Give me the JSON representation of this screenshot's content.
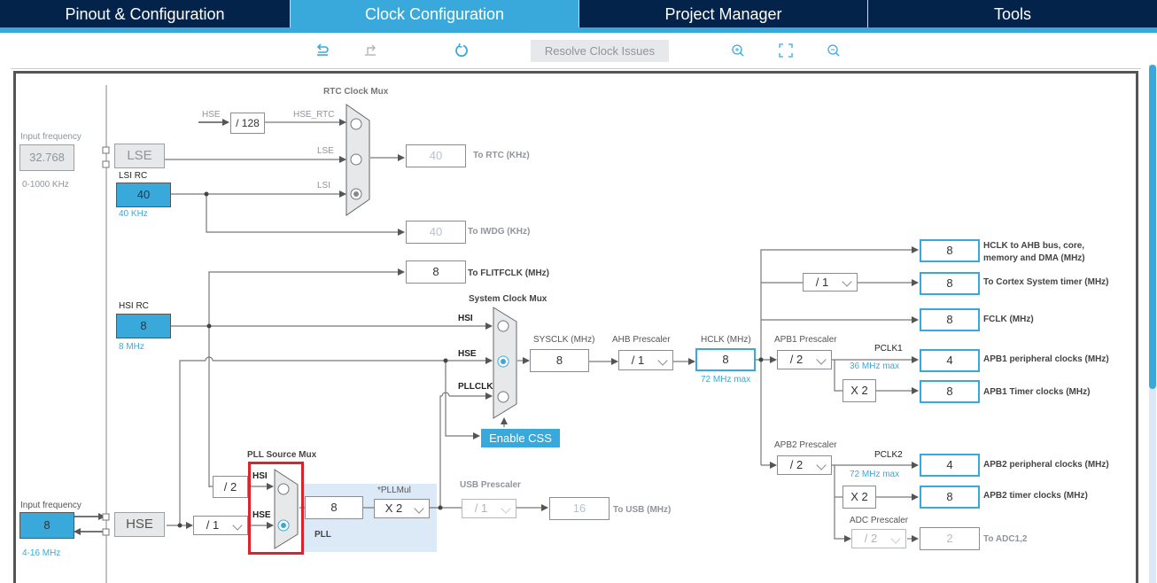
{
  "tabs": [
    {
      "label": "Pinout & Configuration",
      "active": false
    },
    {
      "label": "Clock Configuration",
      "active": true
    },
    {
      "label": "Project Manager",
      "active": false
    },
    {
      "label": "Tools",
      "active": false
    }
  ],
  "toolbar": {
    "undo_icon": "undo-icon",
    "redo_icon": "redo-icon",
    "reset_icon": "refresh-icon",
    "resolve_label": "Resolve Clock Issues",
    "zoom_in_icon": "zoom-in-icon",
    "fit_icon": "fit-screen-icon",
    "zoom_out_icon": "zoom-out-icon"
  },
  "colors": {
    "accent": "#39a9dc",
    "navy": "#03234b",
    "highlight": "#e0202a",
    "pll_bg": "#dce9f7"
  },
  "lse_input": {
    "label": "Input frequency",
    "value": "32.768",
    "range": "0-1000 KHz"
  },
  "lse": {
    "label": "LSE"
  },
  "lsi": {
    "label": "LSI RC",
    "value": "40",
    "unit": "40 KHz"
  },
  "rtc_mux": {
    "title": "RTC Clock Mux",
    "hse_in": "HSE",
    "div": "/ 128",
    "inputs": [
      "HSE_RTC",
      "LSE",
      "LSI"
    ],
    "selected": "LSI"
  },
  "rtc_out": {
    "value": "40",
    "label": "To RTC (KHz)"
  },
  "iwdg_out": {
    "value": "40",
    "label": "To IWDG (KHz)"
  },
  "flitf_out": {
    "value": "8",
    "label": "To FLITFCLK (MHz)"
  },
  "hsi": {
    "label": "HSI RC",
    "value": "8",
    "unit": "8 MHz"
  },
  "sys_mux": {
    "title": "System Clock Mux",
    "inputs": [
      "HSI",
      "HSE",
      "PLLCLK"
    ],
    "selected": "HSE"
  },
  "enable_css": "Enable CSS",
  "sysclk": {
    "label": "SYSCLK (MHz)",
    "value": "8"
  },
  "ahb": {
    "label": "AHB Prescaler",
    "value": "/ 1"
  },
  "hclk": {
    "label": "HCLK (MHz)",
    "value": "8",
    "max": "72 MHz max"
  },
  "cortex_div": "/ 1",
  "outputs": [
    {
      "value": "8",
      "label": "HCLK to AHB bus, core,",
      "label2": "memory and DMA (MHz)"
    },
    {
      "value": "8",
      "label": "To Cortex System timer (MHz)"
    },
    {
      "value": "8",
      "label": "FCLK (MHz)"
    },
    {
      "value": "4",
      "label": "APB1 peripheral clocks (MHz)"
    },
    {
      "value": "8",
      "label": "APB1 Timer clocks (MHz)"
    },
    {
      "value": "4",
      "label": "APB2 peripheral clocks (MHz)"
    },
    {
      "value": "8",
      "label": "APB2 timer clocks (MHz)"
    },
    {
      "value": "2",
      "label": "To ADC1,2"
    }
  ],
  "apb1": {
    "label": "APB1 Prescaler",
    "value": "/ 2",
    "pclk": "PCLK1",
    "max": "36 MHz max",
    "timer_mul": "X 2"
  },
  "apb2": {
    "label": "APB2 Prescaler",
    "value": "/ 2",
    "pclk": "PCLK2",
    "max": "72 MHz max",
    "timer_mul": "X 2"
  },
  "adc": {
    "label": "ADC Prescaler",
    "value": "/ 2"
  },
  "hse_input": {
    "label": "Input frequency",
    "value": "8",
    "range": "4-16 MHz"
  },
  "hse": {
    "label": "HSE",
    "div": "/ 1"
  },
  "pll_src_mux": {
    "title": "PLL Source Mux",
    "hsi_div": "/ 2",
    "inputs": [
      "HSI",
      "HSE"
    ],
    "selected": "HSE"
  },
  "pll": {
    "label": "PLL",
    "value": "8",
    "mul_label": "*PLLMul",
    "mul": "X 2"
  },
  "usb": {
    "label": "USB Prescaler",
    "value": "/ 1",
    "out": "16",
    "out_label": "To USB (MHz)"
  }
}
